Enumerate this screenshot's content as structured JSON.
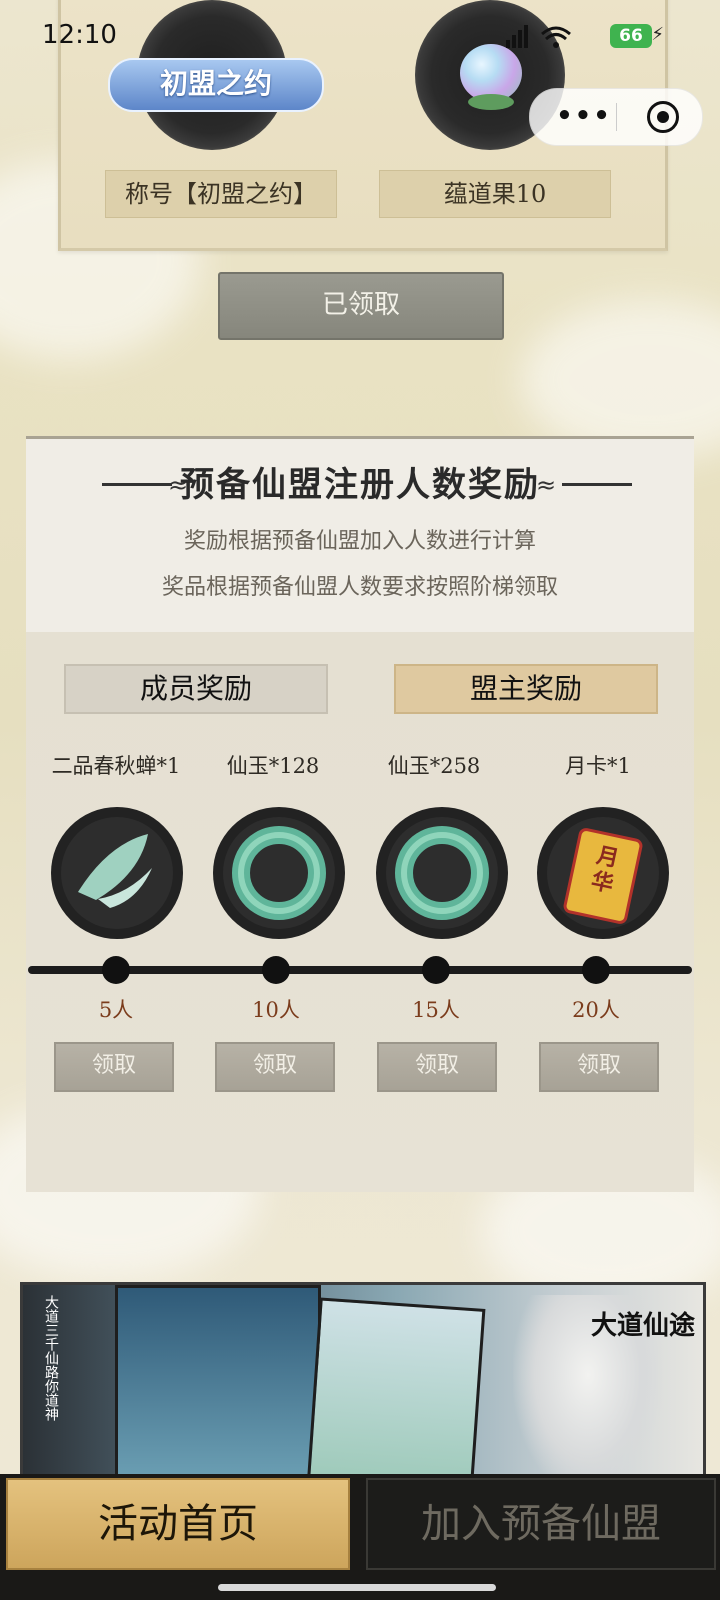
{
  "status_bar": {
    "time": "12:10",
    "battery": "66"
  },
  "top_rewards": {
    "items": [
      {
        "badge": "初盟之约",
        "label": "称号【初盟之约】"
      },
      {
        "label": "蕴道果10"
      }
    ],
    "claimed_button": "已领取"
  },
  "panel": {
    "title": "预备仙盟注册人数奖励",
    "desc_lines": [
      "奖励根据预备仙盟加入人数进行计算",
      "奖品根据预备仙盟人数要求按照阶梯领取"
    ],
    "tabs": [
      "成员奖励",
      "盟主奖励"
    ],
    "rewards": [
      {
        "name": "二品春秋蝉*1",
        "people": "5人",
        "button": "领取"
      },
      {
        "name": "仙玉*128",
        "people": "10人",
        "button": "领取"
      },
      {
        "name": "仙玉*258",
        "people": "15人",
        "button": "领取"
      },
      {
        "name": "月卡*1",
        "people": "20人",
        "button": "领取"
      }
    ],
    "month_card_text": "月华"
  },
  "banner": {
    "vertical_text": "大道三千仙路你道神",
    "brand": "大道仙途"
  },
  "bottom_nav": {
    "home": "活动首页",
    "join": "加入预备仙盟"
  }
}
